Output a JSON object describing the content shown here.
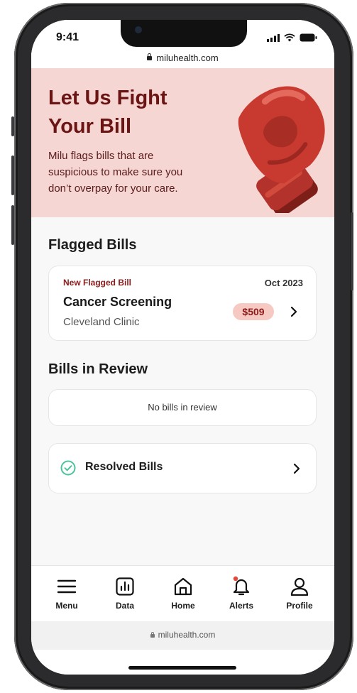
{
  "status_bar": {
    "time": "9:41"
  },
  "browser": {
    "url": "miluhealth.com"
  },
  "hero": {
    "title": "Let Us Fight Your Bill",
    "description": "Milu flags bills that are suspicious to make sure you don’t overpay for your care.",
    "illustration": "boxing-glove-icon",
    "background_color": "#f5d6d3",
    "title_color": "#6b1414"
  },
  "flagged_section": {
    "title": "Flagged Bills",
    "bill": {
      "label": "New Flagged Bill",
      "date": "Oct 2023",
      "name": "Cancer Screening",
      "provider": "Cleveland Clinic",
      "amount": "$509"
    }
  },
  "review_section": {
    "title": "Bills in Review",
    "empty_text": "No bills in review"
  },
  "resolved": {
    "label": "Resolved Bills",
    "icon": "check-circle-icon",
    "icon_color": "#4cc39a"
  },
  "tabbar": {
    "items": [
      {
        "label": "Menu",
        "icon": "menu-icon"
      },
      {
        "label": "Data",
        "icon": "chart-icon"
      },
      {
        "label": "Home",
        "icon": "home-icon"
      },
      {
        "label": "Alerts",
        "icon": "bell-icon",
        "badge_color": "#e5483b"
      },
      {
        "label": "Profile",
        "icon": "profile-icon"
      }
    ]
  },
  "footer": {
    "url": "miluhealth.com"
  }
}
